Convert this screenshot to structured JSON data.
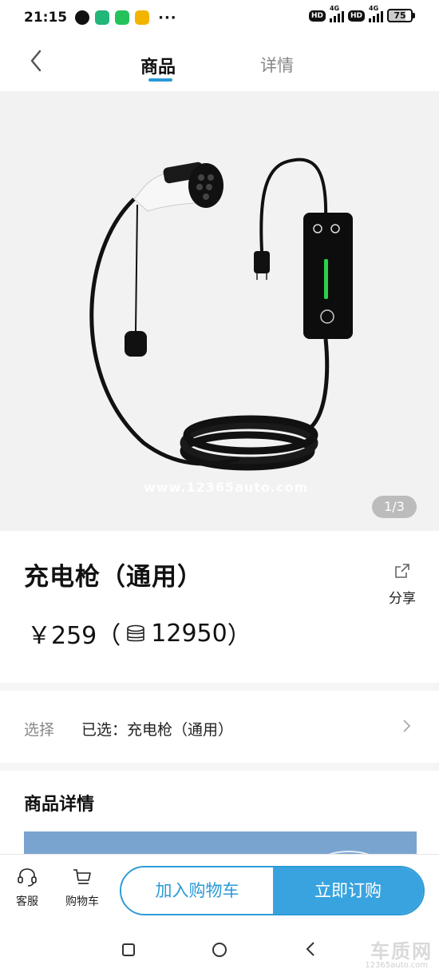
{
  "status_bar": {
    "time": "21:15",
    "more": "···",
    "hd1": "HD",
    "net1": "4G",
    "hd2": "HD",
    "net2": "4G",
    "battery": "75"
  },
  "nav": {
    "tabs": [
      {
        "label": "商品",
        "active": true
      },
      {
        "label": "详情",
        "active": false
      }
    ],
    "accent_color": "#2b9ad6"
  },
  "hero": {
    "watermark": "www.12365auto.com",
    "pager": "1/3"
  },
  "product": {
    "title": "充电枪（通用）",
    "share_label": "分享",
    "price_prefix": "￥259（",
    "points": "12950",
    "price_suffix": "）"
  },
  "select": {
    "label": "选择",
    "value": "已选：充电枪（通用）"
  },
  "detail": {
    "title": "商品详情"
  },
  "action_bar": {
    "service_label": "客服",
    "cart_label": "购物车",
    "add_to_cart": "加入购物车",
    "buy_now": "立即订购"
  },
  "corner": {
    "mark": "车质网",
    "sub": "12365auto.com"
  }
}
